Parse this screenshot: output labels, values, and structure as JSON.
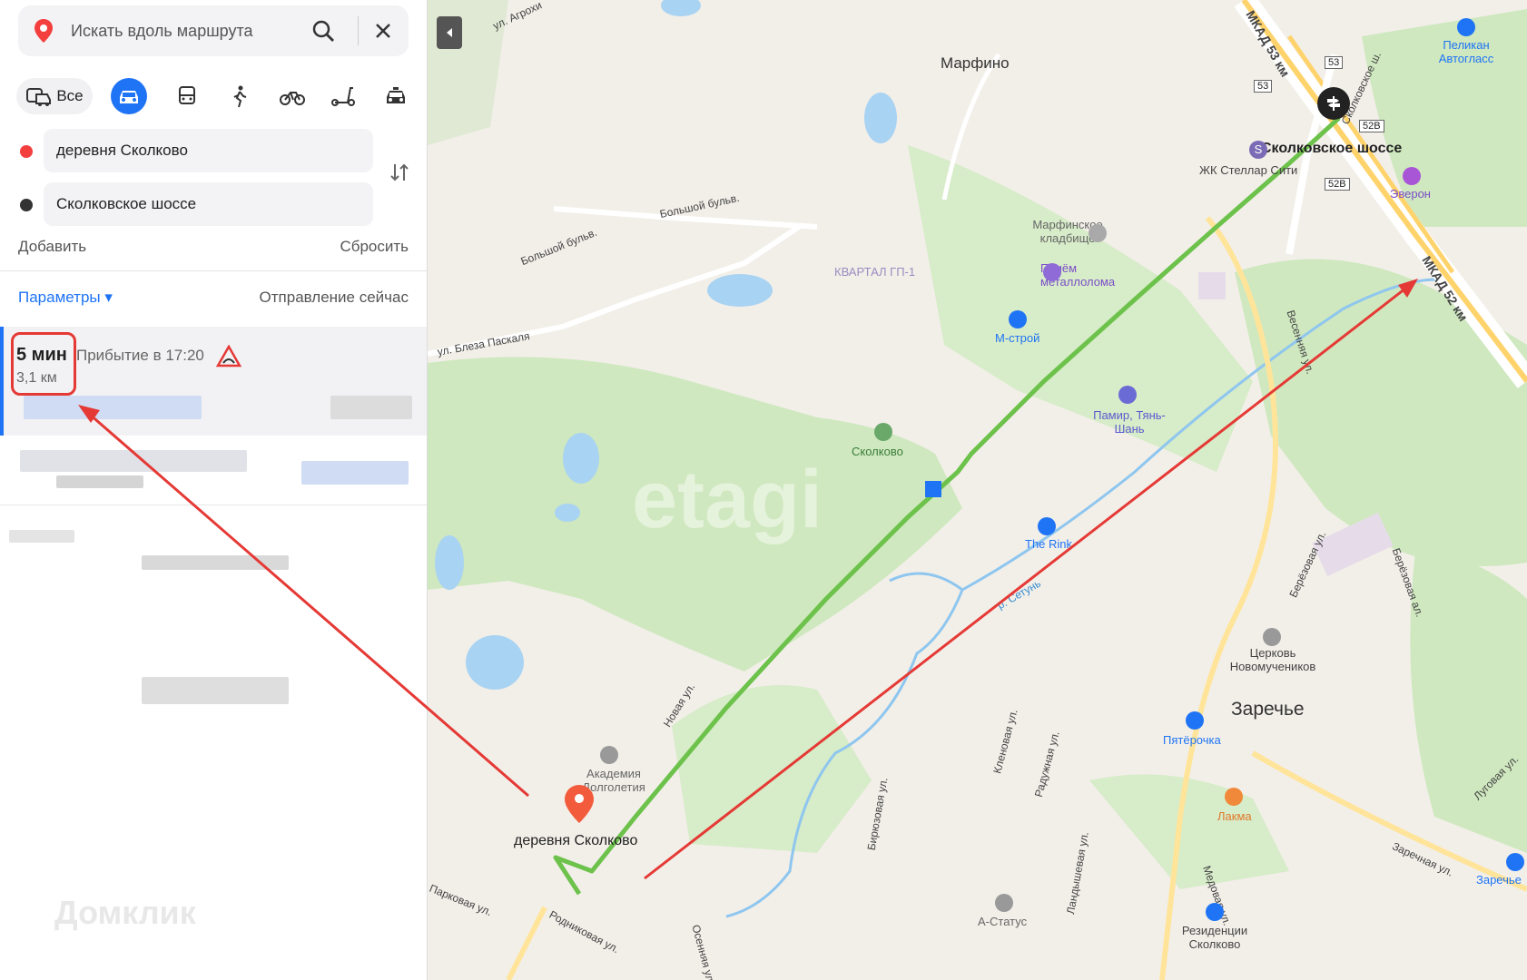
{
  "search": {
    "placeholder": "Искать вдоль маршрута"
  },
  "modes": {
    "all_label": "Все"
  },
  "waypoints": {
    "from": "деревня Сколково",
    "to": "Сколковское шоссе"
  },
  "actions": {
    "add": "Добавить",
    "reset": "Сбросить"
  },
  "params": {
    "label": "Параметры ▾",
    "departure": "Отправление сейчас"
  },
  "route": {
    "duration": "5 мин",
    "distance": "3,1 км",
    "arrival": "Прибытие в 17:20"
  },
  "watermark": "Домклик",
  "map": {
    "labels": {
      "marfino": "Марфино",
      "agroh": "ул. Агрохи",
      "bolshoy1": "Большой бульв.",
      "bolshoy2": "Большой бульв.",
      "paskala": "ул. Блеза Паскаля",
      "kvartal": "КВАРТАЛ ГП-1",
      "cemetery": "Марфинское кладбище",
      "metal": "Приём металлолома",
      "mstroy": "М-строй",
      "skolkovo_park": "Сколково",
      "pamir": "Памир, Тянь-Шань",
      "rink": "The Rink",
      "setun": "р. Сетунь",
      "stop": "Сколковское шоссе",
      "stellar": "ЖК Стеллар Сити",
      "everon": "Эверон",
      "pelikan": "Пеликан Автогласс",
      "mkad53": "МКАД 53 км",
      "mkad52": "МКАД 52 км",
      "shosse": "Сколковское ш.",
      "vesennyaya": "Весенняя ул.",
      "berezovaya": "Берёзовая ул.",
      "berezovaya_al": "Берёзовая ал.",
      "church": "Церковь Новомучеников",
      "zarechye": "Заречье",
      "pyaterochka": "Пятёрочка",
      "lakma": "Лакма",
      "zarechnaya": "Заречная ул.",
      "zarechye_poi": "Заречье",
      "lugovaya": "Луговая ул.",
      "novaya": "Новая ул.",
      "academy": "Академия Долголетия",
      "destination": "деревня Сколково",
      "parkovaya": "Парковая ул.",
      "rodnikovaya": "Родниковая ул.",
      "osennyaya": "Осенняя ул.",
      "biryuzovaya": "Бирюзовая ул.",
      "klenovaya": "Кленовая ул.",
      "raduzhnaya": "Радужная ул.",
      "landysh": "Ландышевая ул.",
      "medovaya": "Медовая ул.",
      "astatus": "А-Статус",
      "residences": "Резиденции Сколково",
      "etagi": "etagi"
    },
    "shields": [
      "53",
      "53",
      "52В",
      "52В"
    ]
  },
  "colors": {
    "accent": "#1f74f5",
    "route": "#6cc24a",
    "annotation": "#e53935",
    "park": "#cfe8bf",
    "water": "#a9d3f2"
  },
  "icons": [
    "location-pin-icon",
    "search-icon",
    "close-icon",
    "car-icon",
    "bus-icon",
    "walk-icon",
    "bike-icon",
    "scooter-icon",
    "taxi-icon",
    "swap-icon",
    "warning-icon"
  ]
}
